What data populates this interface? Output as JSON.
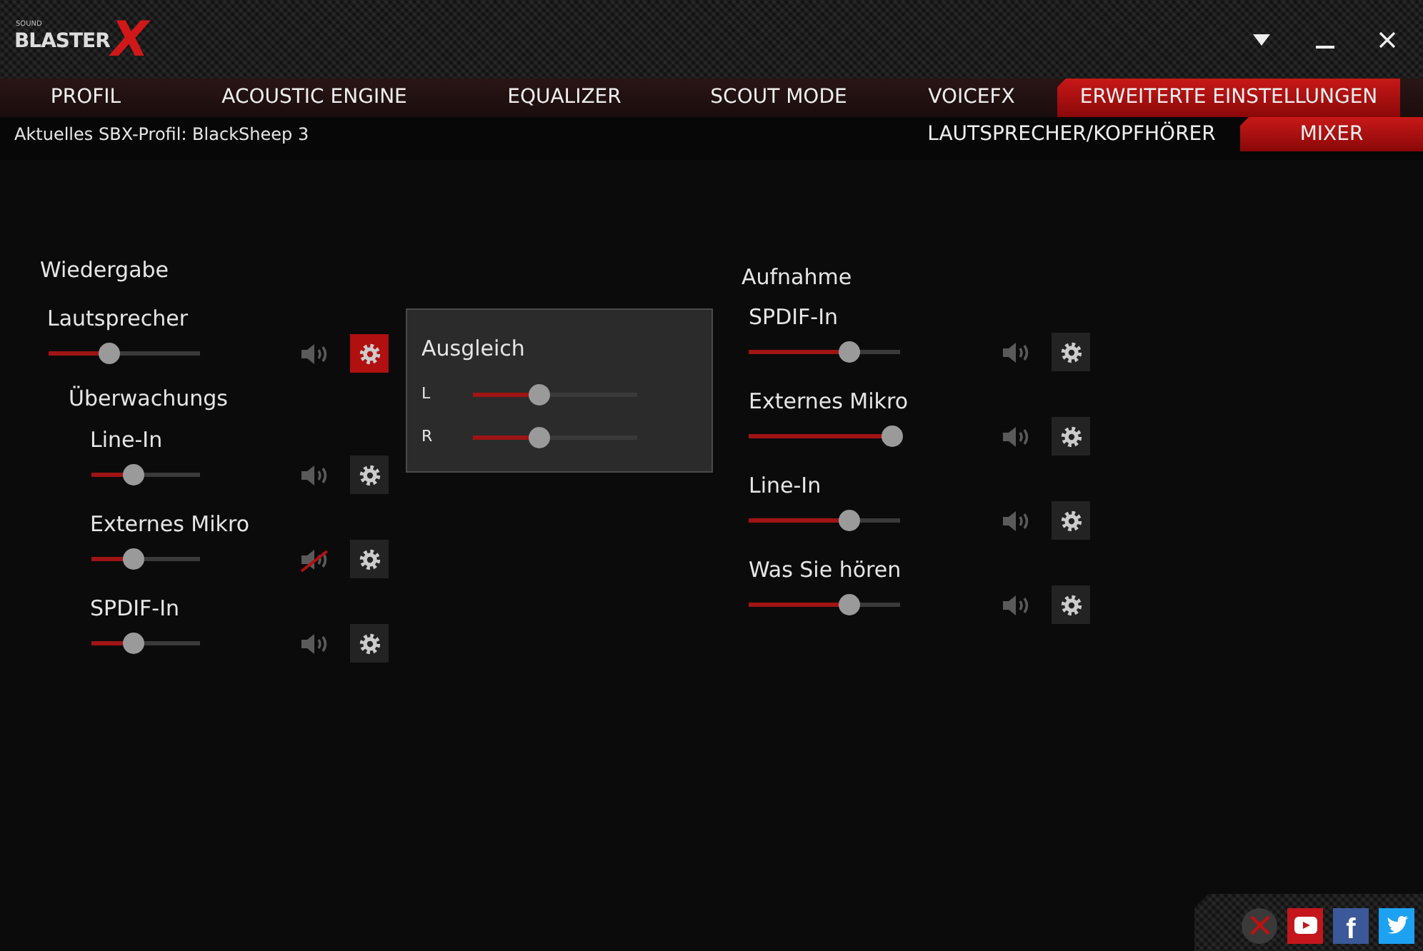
{
  "window": {
    "logo": {
      "small": "SOUND",
      "main": "BLASTER",
      "mark": "X"
    }
  },
  "tabs": [
    {
      "label": "PROFIL",
      "selected": false
    },
    {
      "label": "ACOUSTIC ENGINE",
      "selected": false
    },
    {
      "label": "EQUALIZER",
      "selected": false
    },
    {
      "label": "SCOUT MODE",
      "selected": false
    },
    {
      "label": "VOICEFX",
      "selected": false
    },
    {
      "label": "ERWEITERTE EINSTELLUNGEN",
      "selected": true
    }
  ],
  "profile_text": "Aktuelles SBX-Profil: BlackSheep 3",
  "subtabs": [
    {
      "label": "LAUTSPRECHER/KOPFHÖRER",
      "selected": false
    },
    {
      "label": "MIXER",
      "selected": true
    }
  ],
  "playback": {
    "title": "Wiedergabe",
    "channels": [
      {
        "name": "Lautsprecher",
        "level": 0.4,
        "muted": false,
        "settings_open": true
      }
    ],
    "monitor": {
      "title": "Überwachungs",
      "channels": [
        {
          "name": "Line-In",
          "level": 0.38,
          "muted": false,
          "settings_open": false
        },
        {
          "name": "Externes Mikro",
          "level": 0.38,
          "muted": true,
          "settings_open": false
        },
        {
          "name": "SPDIF-In",
          "level": 0.38,
          "muted": false,
          "settings_open": false
        }
      ]
    }
  },
  "balance_popup": {
    "title": "Ausgleich",
    "channels": [
      {
        "label": "L",
        "level": 0.4
      },
      {
        "label": "R",
        "level": 0.4
      }
    ]
  },
  "recording": {
    "title": "Aufnahme",
    "channels": [
      {
        "name": "SPDIF-In",
        "level": 0.66,
        "muted": false,
        "settings_open": false
      },
      {
        "name": "Externes Mikro",
        "level": 0.94,
        "muted": false,
        "settings_open": false
      },
      {
        "name": "Line-In",
        "level": 0.66,
        "muted": false,
        "settings_open": false
      },
      {
        "name": "Was Sie hören",
        "level": 0.66,
        "muted": false,
        "settings_open": false
      }
    ]
  },
  "footer": {
    "icons": [
      {
        "kind": "close"
      },
      {
        "kind": "youtube"
      },
      {
        "kind": "facebook",
        "glyph": "f"
      },
      {
        "kind": "twitter"
      }
    ]
  }
}
